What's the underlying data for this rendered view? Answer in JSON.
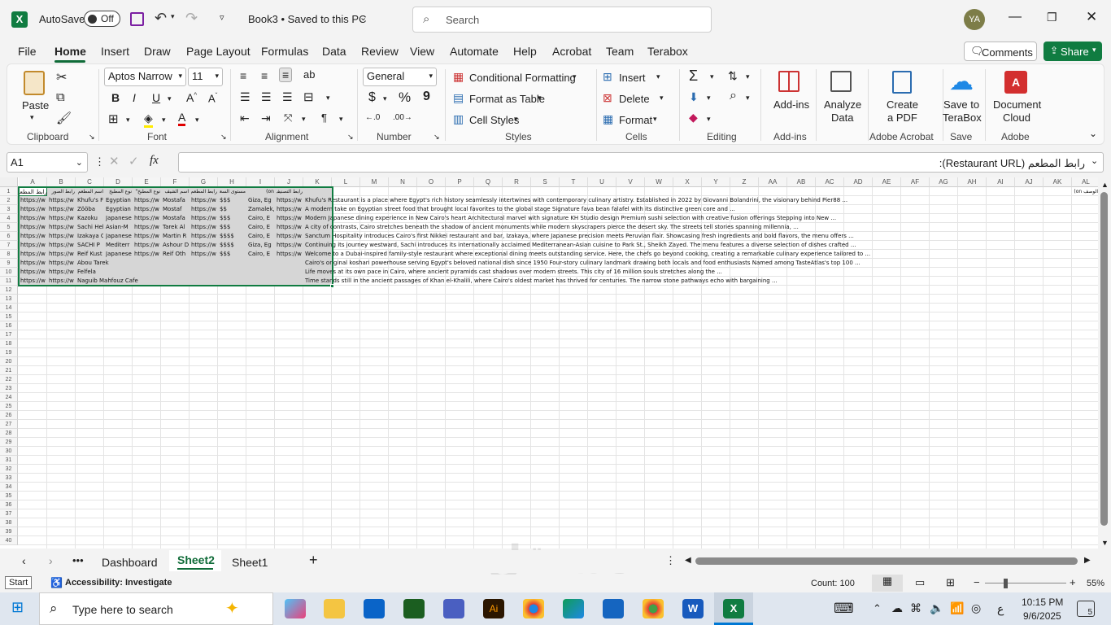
{
  "titlebar": {
    "app_icon": "excel-icon",
    "autosave_label": "AutoSave",
    "autosave_state": "Off",
    "doc_title": "Book3 • Saved to this PC",
    "search_placeholder": "Search",
    "avatar": "YA"
  },
  "menu": [
    "File",
    "Home",
    "Insert",
    "Draw",
    "Page Layout",
    "Formulas",
    "Data",
    "Review",
    "View",
    "Automate",
    "Help",
    "Acrobat",
    "Team",
    "Terabox"
  ],
  "active_menu": "Home",
  "comments_label": "Comments",
  "share_label": "Share",
  "ribbon": {
    "clipboard": {
      "paste": "Paste",
      "group": "Clipboard"
    },
    "font": {
      "name": "Aptos Narrow",
      "size": "11",
      "bold": "B",
      "italic": "I",
      "underline": "U",
      "group": "Font"
    },
    "alignment": {
      "group": "Alignment"
    },
    "number": {
      "format": "General",
      "dollar": "$",
      "percent": "%",
      "comma": "9",
      "group": "Number"
    },
    "styles": {
      "cond": "Conditional Formatting",
      "table": "Format as Table",
      "cell": "Cell Styles",
      "group": "Styles"
    },
    "cells": {
      "insert": "Insert",
      "delete": "Delete",
      "format": "Format",
      "group": "Cells"
    },
    "editing": {
      "group": "Editing"
    },
    "addins": {
      "addins": "Add-ins",
      "group": "Add-ins"
    },
    "analyze": {
      "l1": "Analyze",
      "l2": "Data"
    },
    "acrobat": {
      "l1": "Create",
      "l2": "a PDF",
      "group": "Adobe Acrobat"
    },
    "terabox": {
      "l1": "Save to",
      "l2": "TeraBox",
      "group": "Save"
    },
    "adobe": {
      "l1": "Document",
      "l2": "Cloud",
      "group": "Adobe"
    }
  },
  "formula": {
    "namebox": "A1",
    "fx": "fx",
    "content": "رابط المطعم (Restaurant URL):"
  },
  "columns": [
    "A",
    "B",
    "C",
    "D",
    "E",
    "F",
    "G",
    "H",
    "I",
    "J",
    "K",
    "L",
    "M",
    "N",
    "O",
    "P",
    "Q",
    "R",
    "S",
    "T",
    "U",
    "V",
    "W",
    "X",
    "Y",
    "Z",
    "AA",
    "AB",
    "AC",
    "AD",
    "AE",
    "AF",
    "AG",
    "AH",
    "AI",
    "AJ",
    "AK",
    "AL"
  ],
  "rows": [
    "1",
    "2",
    "3",
    "4",
    "5",
    "6",
    "7",
    "8",
    "9",
    "10",
    "11",
    "12",
    "13",
    "14",
    "15",
    "16",
    "17",
    "18",
    "19",
    "20",
    "21",
    "22",
    "23",
    "24",
    "25",
    "26",
    "27",
    "28",
    "29",
    "30",
    "31",
    "32",
    "33",
    "34",
    "35",
    "36",
    "37",
    "38",
    "39",
    "40"
  ],
  "cells": {
    "header": [
      "رابط المطعم",
      "رابط الصور",
      "اسم المطعم",
      "نوع المطبخ",
      "نوع المطبخ\"",
      "اسم الشيف",
      "رابط المطعم",
      "مستوى السعر",
      "on)",
      "رابط التصنيف",
      "الوصف on)"
    ],
    "r2": [
      "https://w",
      "https://w",
      "Khufu's F",
      "Egyptian",
      "https://w",
      "Mostafa",
      "https://w",
      "$$$",
      "Giza, Eg",
      "https://w",
      "Khufu's Restaurant is a place where Egypt's rich history seamlessly intertwines with contemporary culinary artistry. Established in 2022 by Giovanni Bolandrini, the visionary behind Pier88 ..."
    ],
    "r3": [
      "https://w",
      "https://w",
      "Zööba",
      "Egyptian",
      "https://w",
      "Mostaf",
      "https://w",
      "$$",
      "Zamalek,",
      "https://w",
      "A modern take on Egyptian street food that brought local favorites to the global stage Signature fava bean falafel with its distinctive green core and ..."
    ],
    "r4": [
      "https://w",
      "https://w",
      "Kazoku",
      "Japanese",
      "https://w",
      "Mostafa",
      "https://w",
      "$$$",
      "Cairo, E",
      "https://w",
      "Modern Japanese dining experience in New Cairo's heart Architectural marvel with signature KH Studio design Premium sushi selection with creative fusion offerings Stepping into New ..."
    ],
    "r5": [
      "https://w",
      "https://w",
      "Sachi Hel",
      "Asian-M",
      "https://w",
      "Tarek Al",
      "https://w",
      "$$$",
      "Cairo, E",
      "https://w",
      "A city of contrasts, Cairo stretches beneath the shadow of ancient monuments while modern skyscrapers pierce the desert sky. The streets tell stories spanning millennia, ..."
    ],
    "r6": [
      "https://w",
      "https://w",
      "Izakaya C",
      "Japanese",
      "https://w",
      "Martin R",
      "https://w",
      "$$$$",
      "Cairo, E",
      "https://w",
      "Sanctum Hospitality introduces Cairo's first Nikkei restaurant and bar, Izakaya, where Japanese precision meets Peruvian flair. Showcasing fresh ingredients and bold flavors, the menu offers ..."
    ],
    "r7": [
      "https://w",
      "https://w",
      "SACHI P",
      "Mediterr",
      "https://w",
      "Ashour D",
      "https://w",
      "$$$$",
      "Giza, Eg",
      "https://w",
      "Continuing its journey westward, Sachi introduces its internationally acclaimed Mediterranean-Asian cuisine to Park St., Sheikh Zayed. The menu features a diverse selection of dishes crafted ..."
    ],
    "r8": [
      "https://w",
      "https://w",
      "Reif Kust",
      "Japanese",
      "https://w",
      "Reif Oth",
      "https://w",
      "$$$",
      "Cairo, E",
      "https://w",
      "Welcome to a Dubai-inspired family-style restaurant where exceptional dining meets outstanding service. Here, the chefs go beyond cooking, creating a remarkable culinary experience tailored to ..."
    ],
    "r9": [
      "https://w",
      "https://w",
      "Abou Tarek",
      "",
      "",
      "",
      "",
      "",
      "",
      "",
      "Cairo's original koshari powerhouse serving Egypt's beloved national dish since 1950 Four-story culinary landmark drawing both locals and food enthusiasts Named among TasteAtlas's top 100 ..."
    ],
    "r10": [
      "https://w",
      "https://w",
      "Felfela",
      "",
      "",
      "",
      "",
      "",
      "",
      "",
      "Life moves at its own pace in Cairo, where ancient pyramids cast shadows over modern streets. This city of 16 million souls stretches along the ..."
    ],
    "r11": [
      "https://w",
      "https://w",
      "Naguib Mahfouz Cafe",
      "",
      "",
      "",
      "",
      "",
      "",
      "",
      "Time stands still in the ancient passages of Khan el-Khalili, where Cairo's oldest market has thrived for centuries. The narrow stone pathways echo with bargaining ..."
    ]
  },
  "tabs": [
    "Dashboard",
    "Sheet2",
    "Sheet1"
  ],
  "active_tab": "Sheet2",
  "status": {
    "start": "Start",
    "accessibility": "Accessibility: Investigate",
    "count": "Count: 100",
    "zoom": "55%"
  },
  "taskbar": {
    "search_placeholder": "Type here to search",
    "time": "10:15 PM",
    "date": "9/6/2025",
    "lang": "ع",
    "notif": "5"
  },
  "watermark": "مستقل",
  "colors": {
    "excel_green": "#107c41",
    "accent": "#0f6b38",
    "selection": "#d6d6d6"
  }
}
